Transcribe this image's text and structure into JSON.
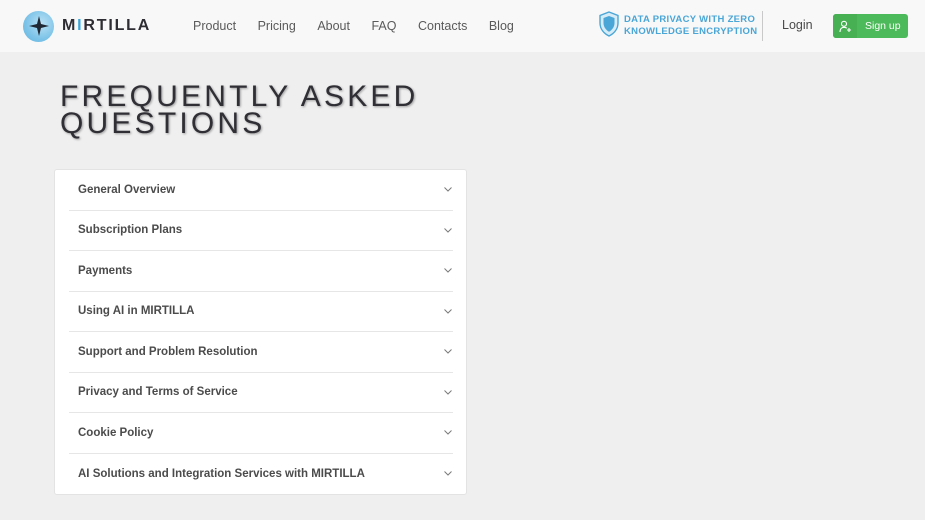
{
  "header": {
    "logo": {
      "text_prefix": "M",
      "text_accent": "I",
      "text_suffix": "RTILLA"
    },
    "nav": [
      {
        "label": "Product"
      },
      {
        "label": "Pricing"
      },
      {
        "label": "About"
      },
      {
        "label": "FAQ"
      },
      {
        "label": "Contacts"
      },
      {
        "label": "Blog"
      }
    ],
    "privacy_line1": "DATA PRIVACY WITH ZERO",
    "privacy_line2": "KNOWLEDGE ENCRYPTION",
    "login_label": "Login",
    "signup_label": "Sign up"
  },
  "page": {
    "title_line1": "FREQUENTLY ASKED",
    "title_line2": "QUESTIONS"
  },
  "faq": {
    "items": [
      {
        "label": "General Overview"
      },
      {
        "label": "Subscription Plans"
      },
      {
        "label": "Payments"
      },
      {
        "label": "Using AI in MIRTILLA"
      },
      {
        "label": "Support and Problem Resolution"
      },
      {
        "label": "Privacy and Terms of Service"
      },
      {
        "label": "Cookie Policy"
      },
      {
        "label": "AI Solutions and Integration Services with MIRTILLA"
      }
    ]
  },
  "icons": {
    "logo": "star-logo-icon",
    "privacy": "shield-icon",
    "signup": "add-user-icon",
    "faq_item": "chevron-down-icon"
  },
  "colors": {
    "accent_blue": "#3aa6db",
    "signup_green": "#4cba5a",
    "background": "#efefef",
    "header_bg": "#f8f8f9"
  }
}
